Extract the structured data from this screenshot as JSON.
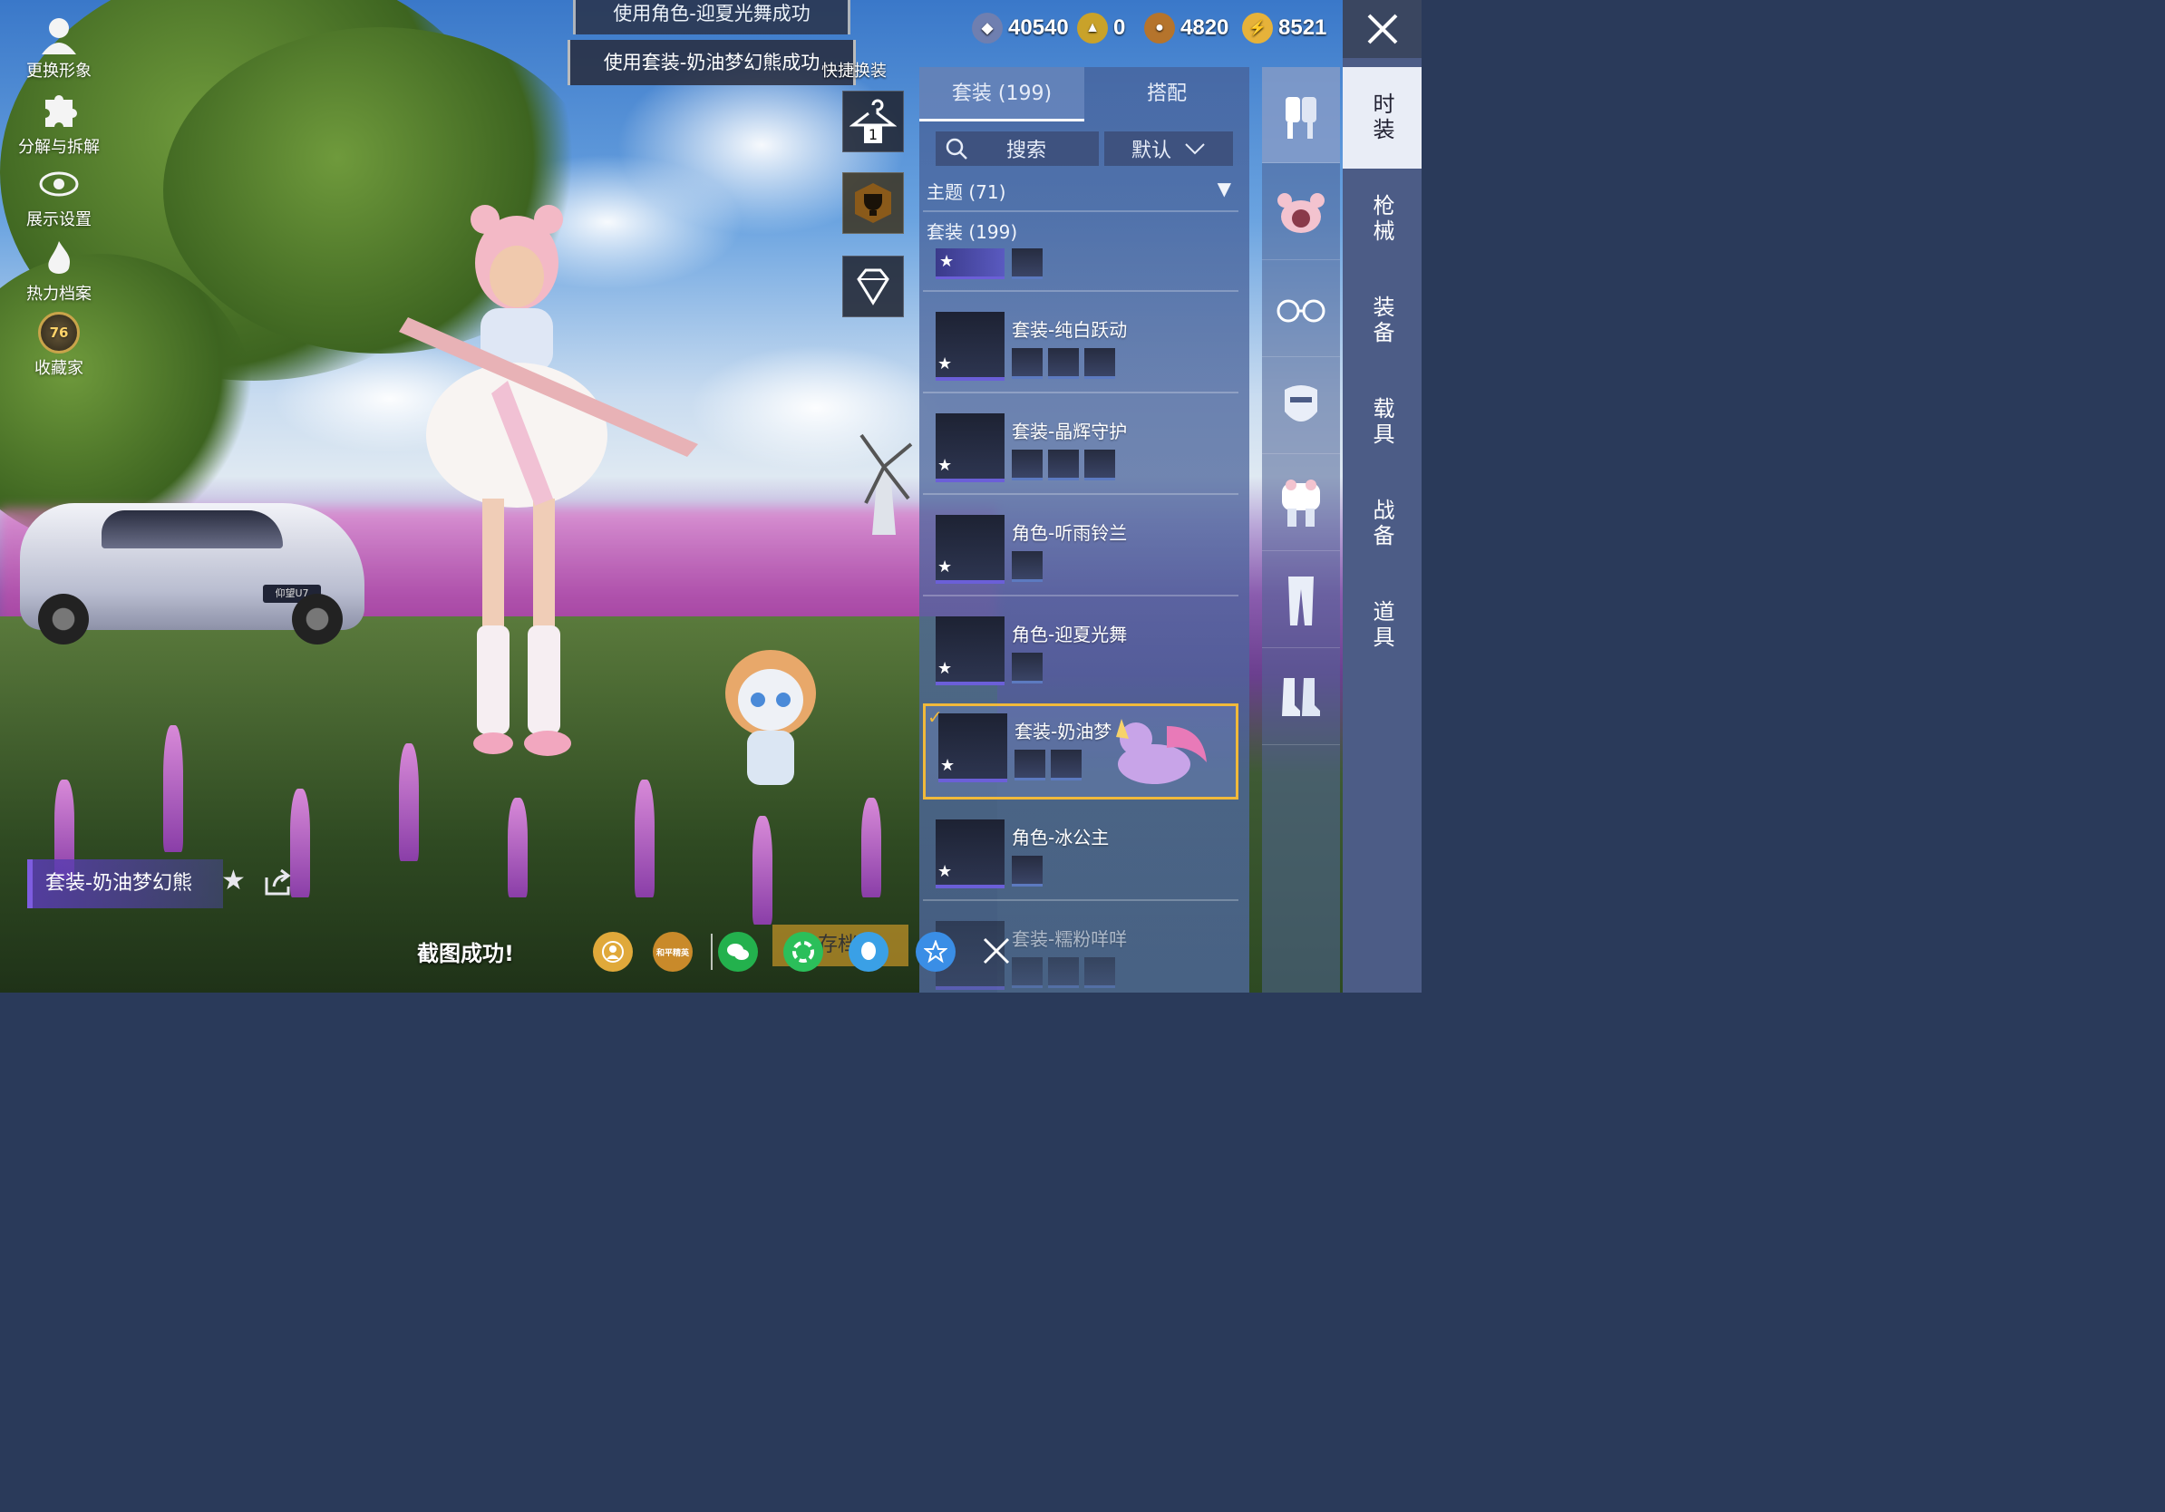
{
  "left_menu": [
    {
      "label": "更换形象",
      "icon": "avatar-icon"
    },
    {
      "label": "分解与拆解",
      "icon": "puzzle-icon"
    },
    {
      "label": "展示设置",
      "icon": "eye-icon"
    },
    {
      "label": "热力档案",
      "icon": "flame-icon"
    },
    {
      "label": "收藏家",
      "icon": "collector-badge-icon",
      "badge": "76"
    }
  ],
  "toasts": {
    "first": "使用角色-迎夏光舞成功",
    "second": "使用套装-奶油梦幻熊成功"
  },
  "quick_change_label": "快捷换装",
  "quick_buttons": [
    "hanger-1-icon",
    "trophy-lock-icon",
    "diamond-lock-icon"
  ],
  "hanger_number": "1",
  "currencies": [
    {
      "icon": "gem-currency-icon",
      "value": "40540",
      "color": "#6f7fb0"
    },
    {
      "icon": "gold-token-icon",
      "value": "0",
      "color": "#c9a22a"
    },
    {
      "icon": "bronze-coin-icon",
      "value": "4820",
      "color": "#b5742c"
    },
    {
      "icon": "lightning-coin-icon",
      "value": "8521",
      "color": "#e6b23a"
    }
  ],
  "panel": {
    "tabs": [
      {
        "label": "套装 (199)"
      },
      {
        "label": "搭配"
      }
    ],
    "search_label": "搜索",
    "sort_label": "默认",
    "theme_label": "主题 (71)",
    "set_header": "套装 (199)",
    "items": [
      {
        "name": "套装-纯白跃动",
        "subs": 3
      },
      {
        "name": "套装-晶辉守护",
        "subs": 3
      },
      {
        "name": "角色-听雨铃兰",
        "subs": 1
      },
      {
        "name": "角色-迎夏光舞",
        "subs": 1
      },
      {
        "name": "套装-奶油梦幻熊",
        "display": "套装-奶油梦",
        "subs": 2,
        "selected": true
      },
      {
        "name": "角色-冰公主",
        "subs": 1
      },
      {
        "name": "套装-糯粉咩咩",
        "subs": 3
      }
    ]
  },
  "categories": [
    "outfit-icon",
    "bear-hat-icon",
    "glasses-icon",
    "mask-icon",
    "top-icon",
    "pants-icon",
    "shoes-icon"
  ],
  "side_tabs": [
    "时装",
    "枪械",
    "装备",
    "载具",
    "战备",
    "道具"
  ],
  "car_plate": "仰望U7",
  "outfit_label": "套装-奶油梦幻熊",
  "screenshot_msg": "截图成功!",
  "share_targets": [
    {
      "icon": "avatar-share-icon",
      "color": "#e0a93a",
      "text": ""
    },
    {
      "icon": "peace-elite-icon",
      "color": "#c98a2a",
      "text": "和平精英"
    },
    {
      "icon": "wechat-icon",
      "color": "#23b14d",
      "text": ""
    },
    {
      "icon": "moments-icon",
      "color": "#2bbf5a",
      "text": ""
    },
    {
      "icon": "qq-icon",
      "color": "#3aa0e6",
      "text": ""
    },
    {
      "icon": "qzone-icon",
      "color": "#3a8ee6",
      "text": ""
    }
  ],
  "save_label": "存档"
}
